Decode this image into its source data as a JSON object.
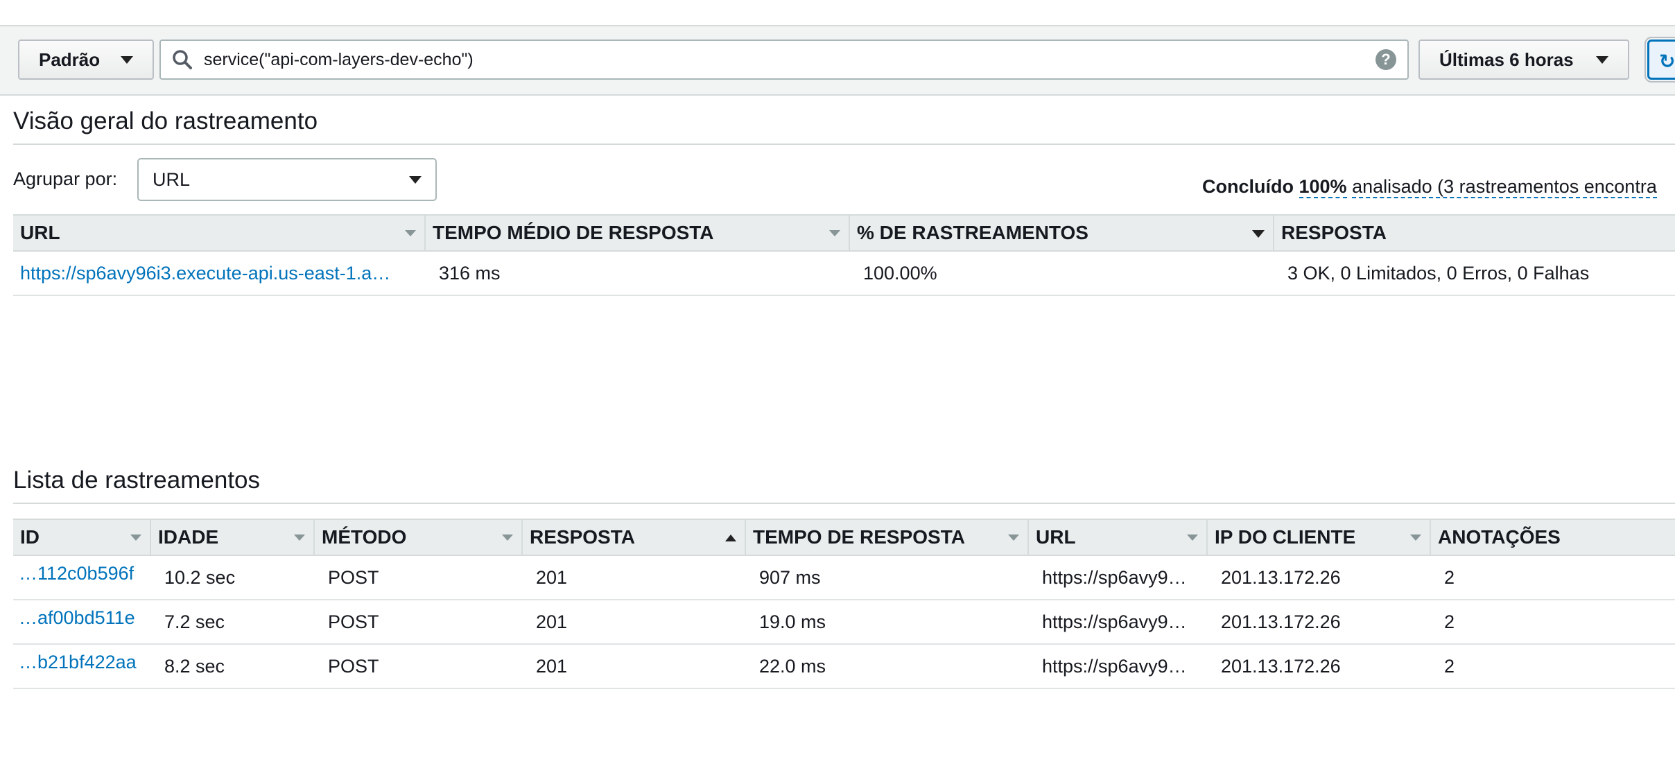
{
  "toolbar": {
    "view_label": "Padrão",
    "search_value": "service(\"api-com-layers-dev-echo\")",
    "help_glyph": "?",
    "time_range_label": "Últimas 6 horas",
    "refresh_glyph": "↻"
  },
  "overview": {
    "title": "Visão geral do rastreamento",
    "group_by_label": "Agrupar por:",
    "group_by_value": "URL",
    "status": {
      "prefix": "Concluído",
      "percent": "100%",
      "suffix": "analisado (3 rastreamentos encontra"
    },
    "columns": [
      "URL",
      "TEMPO MÉDIO DE RESPOSTA",
      "% DE RASTREAMENTOS",
      "RESPOSTA"
    ],
    "rows": [
      {
        "url": "https://sp6avy96i3.execute-api.us-east-1.a…",
        "avg_response": "316 ms",
        "percent": "100.00%",
        "response": "3 OK, 0 Limitados, 0 Erros, 0 Falhas"
      }
    ]
  },
  "trace_list": {
    "title": "Lista de rastreamentos",
    "columns": [
      "ID",
      "IDADE",
      "MÉTODO",
      "RESPOSTA",
      "TEMPO DE RESPOSTA",
      "URL",
      "IP DO CLIENTE",
      "ANOTAÇÕES"
    ],
    "rows": [
      {
        "id": "…112c0b596f",
        "age": "10.2 sec",
        "method": "POST",
        "response": "201",
        "response_time": "907 ms",
        "url": "https://sp6avy9…",
        "client_ip": "201.13.172.26",
        "annotations": "2"
      },
      {
        "id": "…af00bd511e",
        "age": "7.2 sec",
        "method": "POST",
        "response": "201",
        "response_time": "19.0 ms",
        "url": "https://sp6avy9…",
        "client_ip": "201.13.172.26",
        "annotations": "2"
      },
      {
        "id": "…b21bf422aa",
        "age": "8.2 sec",
        "method": "POST",
        "response": "201",
        "response_time": "22.0 ms",
        "url": "https://sp6avy9…",
        "client_ip": "201.13.172.26",
        "annotations": "2"
      }
    ]
  },
  "colors": {
    "link": "#0073bb",
    "toolbar_bg": "#f2f3f3",
    "header_bg": "#eaeded"
  }
}
